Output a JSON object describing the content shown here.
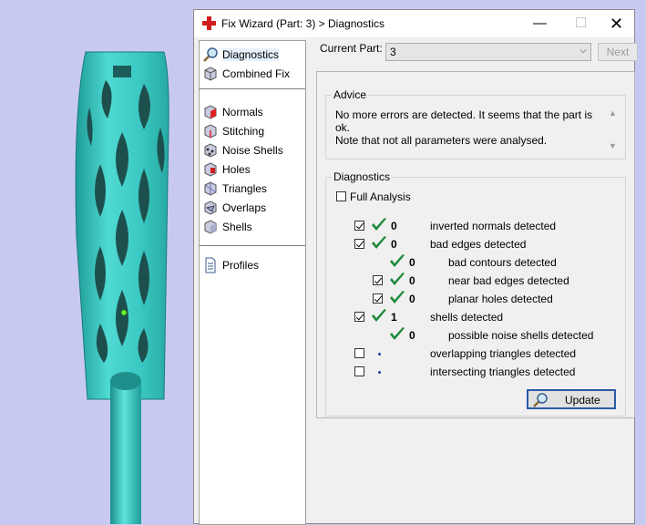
{
  "window": {
    "title": "Fix Wizard (Part: 3) > Diagnostics",
    "controls": {
      "minimize": "—",
      "maximize": "☐",
      "close": "✕"
    }
  },
  "sidebar": {
    "items": [
      {
        "label": "Diagnostics",
        "icon": "magnifier-icon",
        "selected": true
      },
      {
        "label": "Combined Fix",
        "icon": "cube-icon"
      },
      {
        "label": "Normals",
        "icon": "normals-cube-icon"
      },
      {
        "label": "Stitching",
        "icon": "stitching-cube-icon"
      },
      {
        "label": "Noise Shells",
        "icon": "noise-shells-icon"
      },
      {
        "label": "Holes",
        "icon": "holes-icon"
      },
      {
        "label": "Triangles",
        "icon": "triangles-icon"
      },
      {
        "label": "Overlaps",
        "icon": "overlaps-icon"
      },
      {
        "label": "Shells",
        "icon": "shells-icon"
      },
      {
        "label": "Profiles",
        "icon": "document-icon"
      }
    ]
  },
  "main": {
    "current_part_label": "Current Part:",
    "current_part_value": "3",
    "next_label": "Next",
    "advice": {
      "legend": "Advice",
      "line1": "No more errors are detected. It seems that the part is ok.",
      "line2": "Note that not all parameters were analysed."
    },
    "diagnostics": {
      "legend": "Diagnostics",
      "full_analysis_label": "Full Analysis",
      "full_analysis_checked": false,
      "rows": [
        {
          "label": "inverted normals detected",
          "count": "0",
          "checked": true,
          "status": "ok",
          "indent": 0
        },
        {
          "label": "bad edges detected",
          "count": "0",
          "checked": true,
          "status": "ok",
          "indent": 0
        },
        {
          "label": "bad contours detected",
          "count": "0",
          "checked": null,
          "status": "ok",
          "indent": 1
        },
        {
          "label": "near bad edges detected",
          "count": "0",
          "checked": true,
          "status": "ok",
          "indent": 1
        },
        {
          "label": "planar holes detected",
          "count": "0",
          "checked": true,
          "status": "ok",
          "indent": 1
        },
        {
          "label": "shells detected",
          "count": "1",
          "checked": true,
          "status": "ok",
          "indent": 0
        },
        {
          "label": "possible noise shells detected",
          "count": "0",
          "checked": null,
          "status": "ok",
          "indent": 1
        },
        {
          "label": "overlapping triangles detected",
          "count": "",
          "checked": false,
          "status": "not-analysed",
          "indent": 0
        },
        {
          "label": "intersecting triangles detected",
          "count": "",
          "checked": false,
          "status": "not-analysed",
          "indent": 0
        }
      ]
    },
    "update_label": "Update"
  },
  "colors": {
    "viewport_bg": "#c8c9f2",
    "part_color": "#3cc9c3",
    "tick_green": "#1e8a3a",
    "not_analysed_dot": "#1a3fa8"
  }
}
